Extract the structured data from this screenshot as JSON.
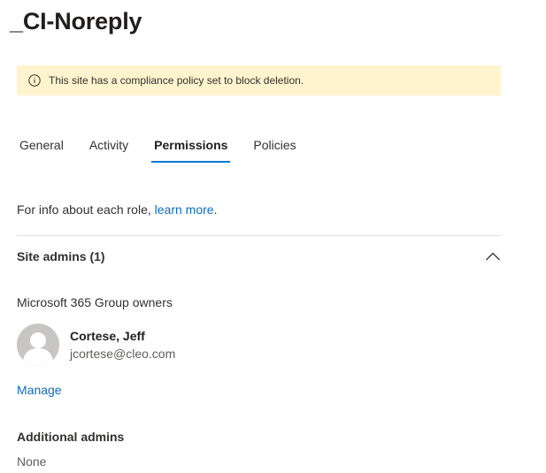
{
  "page": {
    "title": "_CI-Noreply"
  },
  "banner": {
    "icon": "info-icon",
    "text": "This site has a compliance policy set to block deletion.",
    "background": "#fff4ce"
  },
  "tabs": [
    {
      "label": "General",
      "active": false
    },
    {
      "label": "Activity",
      "active": false
    },
    {
      "label": "Permissions",
      "active": true
    },
    {
      "label": "Policies",
      "active": false
    }
  ],
  "info": {
    "prefix": "For info about each role, ",
    "link_text": "learn more",
    "suffix": "."
  },
  "site_admins": {
    "header": "Site admins (1)",
    "collapse_icon": "chevron-up-icon",
    "group_label": "Microsoft 365 Group owners",
    "owner": {
      "avatar_icon": "person-avatar-icon",
      "name": "Cortese, Jeff",
      "email": "jcortese@cleo.com"
    },
    "manage_label": "Manage"
  },
  "additional_admins": {
    "title": "Additional admins",
    "value": "None"
  },
  "colors": {
    "accent": "#0078d4",
    "link": "#0f6cbd",
    "divider": "#e1dfdd"
  }
}
